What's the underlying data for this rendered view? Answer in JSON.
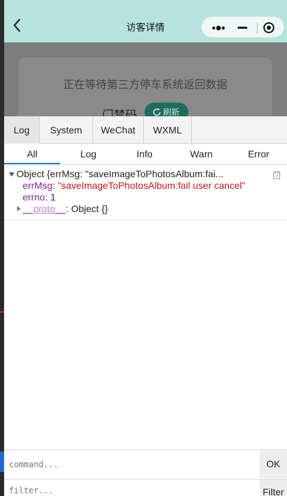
{
  "navbar": {
    "title": "访客详情",
    "back_icon": "chevron-left-icon",
    "capsule_icons": [
      "more-dots-icon",
      "minimize-icon",
      "target-icon"
    ]
  },
  "card": {
    "waiting_text": "正在等待第三方停车系统返回数据",
    "gate_label": "门禁码",
    "refresh_label": "刷新"
  },
  "devtools": {
    "panel_tabs": [
      "Log",
      "System",
      "WeChat",
      "WXML"
    ],
    "active_panel_tab": "Log",
    "level_tabs": [
      "All",
      "Log",
      "Info",
      "Warn",
      "Error"
    ],
    "active_level_tab": "All",
    "log_entry": {
      "summary": "Object {errMsg: \"saveImageToPhotosAlbum:fai...",
      "errMsg_key": "errMsg",
      "errMsg_value": "\"saveImageToPhotosAlbum:fail user cancel\"",
      "errno_key": "errno",
      "errno_value": "1",
      "proto_key": "__proto__",
      "proto_value": ": Object {}"
    },
    "command_placeholder": "command...",
    "ok_label": "OK",
    "filter_placeholder": "filter...",
    "filter_label": "Filter"
  },
  "colors": {
    "navbar_bg": "#b6e3de",
    "refresh_bg": "#1e6d60",
    "active_tab_underline": "#2b82d9"
  }
}
